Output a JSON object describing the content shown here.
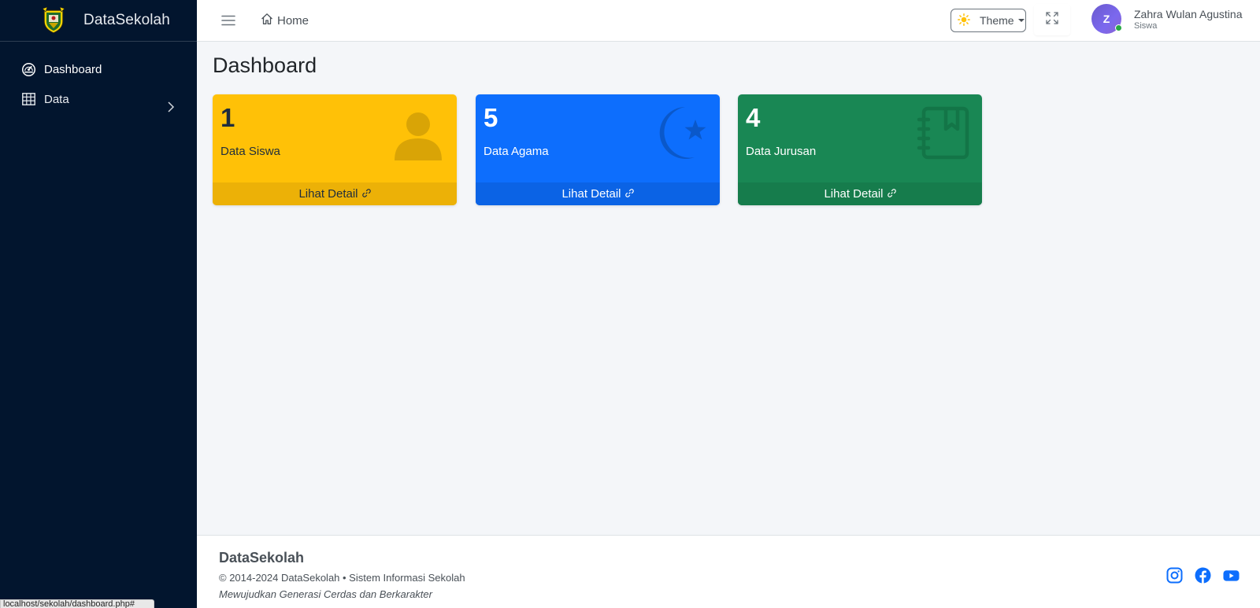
{
  "brand": {
    "name": "DataSekolah",
    "logo": "school-crest-logo"
  },
  "sidebar": {
    "items": [
      {
        "label": "Dashboard",
        "icon": "speedometer-icon",
        "active": true
      },
      {
        "label": "Data",
        "icon": "table-icon",
        "has_submenu": true
      }
    ]
  },
  "header": {
    "home_label": "Home",
    "theme_label": "Theme",
    "user": {
      "initial": "Z",
      "name": "Zahra Wulan Agustina",
      "role": "Siswa",
      "status": "online"
    }
  },
  "main": {
    "title": "Dashboard",
    "cards": [
      {
        "count": "1",
        "label": "Data Siswa",
        "link": "Lihat Detail",
        "icon": "person-icon",
        "color": "#ffc107"
      },
      {
        "count": "5",
        "label": "Data Agama",
        "link": "Lihat Detail",
        "icon": "star-and-crescent-icon",
        "color": "#0d6efd"
      },
      {
        "count": "4",
        "label": "Data Jurusan",
        "link": "Lihat Detail",
        "icon": "journal-bookmark-icon",
        "color": "#198754"
      }
    ]
  },
  "footer": {
    "brand": "DataSekolah",
    "copyright": "© 2014-2024 DataSekolah • Sistem Informasi Sekolah",
    "tagline": "Mewujudkan Generasi Cerdas dan Berkarakter",
    "socials": [
      "instagram-icon",
      "facebook-icon",
      "youtube-icon"
    ]
  },
  "status_bar": {
    "url": "localhost/sekolah/dashboard.php#"
  },
  "colors": {
    "sidebar_bg": "#02152e",
    "accent_blue": "#0d6efd",
    "warning": "#ffc107",
    "success": "#198754"
  }
}
